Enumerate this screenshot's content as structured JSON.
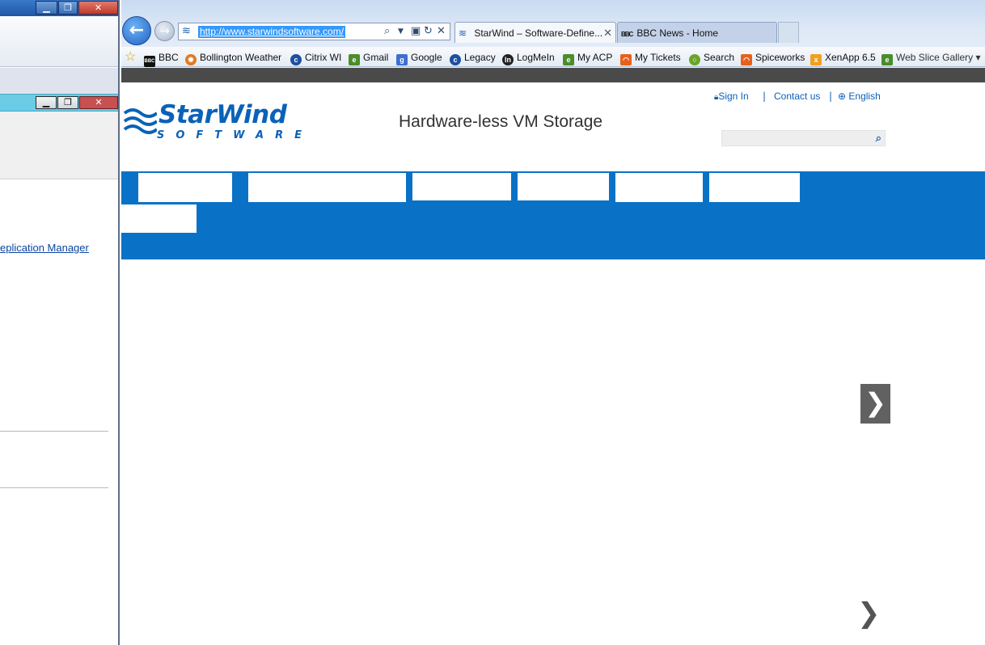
{
  "left_window": {
    "minimize": "▁",
    "restore": "❐",
    "close": "✕",
    "link_text": "eplication Manager"
  },
  "browser": {
    "address_url": "http://www.starwindsoftware.com/",
    "tabs": [
      {
        "label": "StarWind – Software-Define...",
        "active": true
      },
      {
        "label": "BBC News - Home",
        "active": false
      }
    ],
    "favorites": [
      {
        "label": "BBC",
        "icon": "bbc-icon",
        "color": "#111111"
      },
      {
        "label": "Bollington Weather",
        "icon": "weather-sun-icon",
        "color": "#e07b20"
      },
      {
        "label": "Citrix WI",
        "icon": "citrix-icon",
        "color": "#1f4f9e"
      },
      {
        "label": "Gmail",
        "icon": "ie-page-icon",
        "color": "#4a8d2a"
      },
      {
        "label": "Google",
        "icon": "google-icon",
        "color": "#3d6fd0"
      },
      {
        "label": "Legacy",
        "icon": "citrix-icon",
        "color": "#1f4f9e"
      },
      {
        "label": "LogMeIn",
        "icon": "logmein-icon",
        "color": "#222222"
      },
      {
        "label": "My ACP",
        "icon": "ie-page-icon",
        "color": "#4a8d2a"
      },
      {
        "label": "My Tickets",
        "icon": "spiceworks-icon",
        "color": "#e8611a"
      },
      {
        "label": "Search",
        "icon": "search-green-icon",
        "color": "#6aa52a"
      },
      {
        "label": "Spiceworks",
        "icon": "spiceworks-icon",
        "color": "#e8611a"
      },
      {
        "label": "XenApp 6.5",
        "icon": "xenapp-icon",
        "color": "#f0a020"
      },
      {
        "label": "Web Slice Gallery ▾",
        "icon": "ie-page-icon",
        "color": "#4a8d2a"
      }
    ]
  },
  "site": {
    "sign_in": "Sign In",
    "contact": "Contact us",
    "language": "English",
    "logo_main": "StarWind",
    "logo_sub": "SOFTWARE",
    "tagline": "Hardware-less VM Storage",
    "search_placeholder": "",
    "next_arrow": "❯",
    "next_arrow_plain": "❯",
    "brand_color": "#0a72c6"
  }
}
